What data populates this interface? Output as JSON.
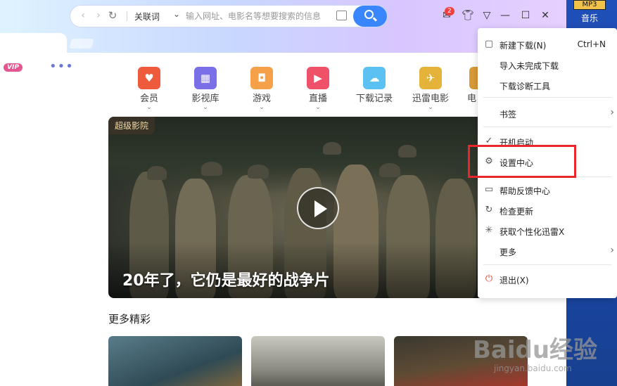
{
  "desktop": {
    "icon_text": "MP3",
    "icon_label": "音乐"
  },
  "toolbar": {
    "assoc_label": "关联词",
    "search_placeholder": "输入网址、电影名等想要搜索的信息",
    "notify_badge": "2"
  },
  "side": {
    "vip_label": "VIP",
    "more_dots": "•••"
  },
  "features": [
    {
      "label": "会员",
      "color": "#ee5a3c",
      "icon": "vip-heart-icon"
    },
    {
      "label": "影视库",
      "color": "#7b6fe8",
      "icon": "film-icon"
    },
    {
      "label": "游戏",
      "color": "#f5a14a",
      "icon": "gamepad-icon"
    },
    {
      "label": "直播",
      "color": "#ef5168",
      "icon": "tv-icon"
    },
    {
      "label": "下载记录",
      "color": "#5bc1f2",
      "icon": "cloud-icon"
    },
    {
      "label": "迅雷电影",
      "color": "#e5b33a",
      "icon": "bird-icon"
    },
    {
      "label": "电",
      "color": "#d89a37",
      "icon": "more-icon"
    }
  ],
  "hero": {
    "tag": "超级影院",
    "caption": "20年了，它仍是最好的战争片"
  },
  "more_section": {
    "title": "更多精彩"
  },
  "menu": {
    "items": [
      {
        "label": "新建下载(N)",
        "shortcut": "Ctrl+N",
        "icon": "new-download-icon"
      },
      {
        "label": "导入未完成下载",
        "icon": ""
      },
      {
        "label": "下载诊断工具",
        "icon": ""
      },
      {
        "label": "书签",
        "icon": "",
        "submenu": true
      },
      {
        "label": "开机启动",
        "icon": "check-icon"
      },
      {
        "label": "设置中心",
        "icon": "gear-icon"
      },
      {
        "label": "帮助反馈中心",
        "icon": "feedback-icon"
      },
      {
        "label": "检查更新",
        "icon": "refresh-icon"
      },
      {
        "label": "获取个性化迅雷X",
        "icon": "sparkle-icon"
      },
      {
        "label": "更多",
        "icon": "",
        "submenu": true
      },
      {
        "label": "退出(X)",
        "icon": "power-icon"
      }
    ]
  },
  "watermark": {
    "big": "Baidu经验",
    "small": "jingyan.baidu.com"
  }
}
